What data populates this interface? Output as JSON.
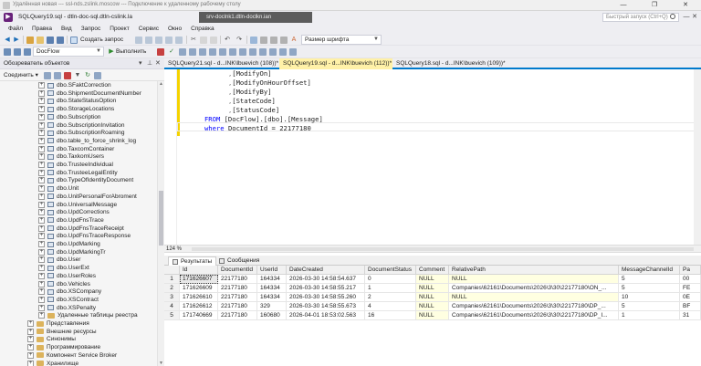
{
  "rdp": {
    "title": "Удалённая новая --- ssl-nds.zslink.moscow --- Подключение к удаленному рабочему столу",
    "buttons": [
      "—",
      "❐",
      "✕"
    ]
  },
  "ssms": {
    "doc_title": "SQLQuery19.sql - dtln-doc-sql.dtln-cslink.la",
    "connection": "srv-doclnk1.dtln-doclkn.ian",
    "quick_launch_placeholder": "Быстрый запуск (Ctrl+Q)",
    "caption_buttons": [
      "—",
      "❐",
      "✕"
    ]
  },
  "menu": [
    "Файл",
    "Правка",
    "Вид",
    "Запрос",
    "Проект",
    "Сервис",
    "Окно",
    "Справка"
  ],
  "toolbar1": {
    "new_query": "Создать запрос",
    "font_size_combo": "Размер шрифта"
  },
  "toolbar2": {
    "database": "DocFlow",
    "execute": "Выполнить"
  },
  "object_explorer": {
    "title": "Обозреватель объектов",
    "connect": "Соединить",
    "items": [
      {
        "label": "dbo.SFaktCorrection",
        "kind": "table"
      },
      {
        "label": "dbo.ShipmentDocumentNumber",
        "kind": "table"
      },
      {
        "label": "dbo.StateStatusOption",
        "kind": "table"
      },
      {
        "label": "dbo.StorageLocations",
        "kind": "table"
      },
      {
        "label": "dbo.Subscription",
        "kind": "table"
      },
      {
        "label": "dbo.SubscriptionInvitation",
        "kind": "table"
      },
      {
        "label": "dbo.SubscriptionRoaming",
        "kind": "table"
      },
      {
        "label": "dbo.table_to_force_shrink_log",
        "kind": "table"
      },
      {
        "label": "dbo.TaxcomContainer",
        "kind": "table"
      },
      {
        "label": "dbo.TaxkomUsers",
        "kind": "table"
      },
      {
        "label": "dbo.TrusteeIndividual",
        "kind": "table"
      },
      {
        "label": "dbo.TrusteeLegalEntity",
        "kind": "table"
      },
      {
        "label": "dbo.TypeOfIdentityDocument",
        "kind": "table"
      },
      {
        "label": "dbo.Unit",
        "kind": "table"
      },
      {
        "label": "dbo.UnitPersonalForAbroment",
        "kind": "table"
      },
      {
        "label": "dbo.UniversalMessage",
        "kind": "table"
      },
      {
        "label": "dbo.UpdCorrections",
        "kind": "table"
      },
      {
        "label": "dbo.UpdFnsTrace",
        "kind": "table"
      },
      {
        "label": "dbo.UpdFnsTraceReceipt",
        "kind": "table"
      },
      {
        "label": "dbo.UpdFnsTraceResponse",
        "kind": "table"
      },
      {
        "label": "dbo.UpdMarking",
        "kind": "table"
      },
      {
        "label": "dbo.UpdMarkingTr",
        "kind": "table"
      },
      {
        "label": "dbo.User",
        "kind": "table"
      },
      {
        "label": "dbo.UserExt",
        "kind": "table"
      },
      {
        "label": "dbo.UserRoles",
        "kind": "table"
      },
      {
        "label": "dbo.Vehicles",
        "kind": "table"
      },
      {
        "label": "dbo.XSCompany",
        "kind": "table"
      },
      {
        "label": "dbo.XSContract",
        "kind": "table"
      },
      {
        "label": "dbo.XSPenalty",
        "kind": "table"
      },
      {
        "label": "Удаленные таблицы реестра",
        "kind": "folder"
      },
      {
        "label": "Представления",
        "kind": "folder-root"
      },
      {
        "label": "Внешние ресурсы",
        "kind": "folder-root"
      },
      {
        "label": "Синонимы",
        "kind": "folder-root"
      },
      {
        "label": "Программирование",
        "kind": "folder-root"
      },
      {
        "label": "Компонент Service Broker",
        "kind": "folder-root"
      },
      {
        "label": "Хранилище",
        "kind": "folder-root"
      }
    ]
  },
  "tabs": [
    {
      "label": "SQLQuery21.sql - d...INK\\lbuevich (108))*",
      "active": false
    },
    {
      "label": "SQLQuery19.sql - d...INK\\buevich (112))*",
      "active": true
    },
    {
      "label": "SQLQuery18.sql - d...INK\\buevich (109))*",
      "active": false
    }
  ],
  "editor": {
    "lines": [
      {
        "indent": "            ",
        "pre": ",",
        "text": "[ModifyOn]",
        "post": ""
      },
      {
        "indent": "            ",
        "pre": ",",
        "text": "[ModifyOnHourOffset]",
        "post": ""
      },
      {
        "indent": "            ",
        "pre": ",",
        "text": "[ModifyBy]",
        "post": ""
      },
      {
        "indent": "            ",
        "pre": ",",
        "text": "[StateCode]",
        "post": ""
      },
      {
        "indent": "            ",
        "pre": ",",
        "text": "[StatusCode]",
        "post": ""
      }
    ],
    "from_kw": "FROM",
    "from_obj": "[DocFlow].[dbo].[Message]",
    "where_kw": "where",
    "where_expr": "DocumentId = 22177180"
  },
  "zoom": "124 %",
  "result_tabs": [
    "Результаты",
    "Сообщения"
  ],
  "grid": {
    "columns": [
      "Id",
      "DocumentId",
      "UserId",
      "DateCreated",
      "DocumentStatus",
      "Comment",
      "RelativePath",
      "MessageChannelId",
      "Pa"
    ],
    "rows": [
      [
        "1",
        "171626607",
        "22177180",
        "164334",
        "2026-03-30 14:58:54.637",
        "0",
        "NULL",
        "NULL",
        "5",
        "00"
      ],
      [
        "2",
        "171626609",
        "22177180",
        "164334",
        "2026-03-30 14:58:55.217",
        "1",
        "NULL",
        "Companies\\62161\\Documents\\2026\\3\\30\\22177180\\ON_...",
        "5",
        "FE"
      ],
      [
        "3",
        "171626610",
        "22177180",
        "164334",
        "2026-03-30 14:58:55.260",
        "2",
        "NULL",
        "NULL",
        "10",
        "0E"
      ],
      [
        "4",
        "171626612",
        "22177180",
        "329",
        "2026-03-30 14:58:55.673",
        "4",
        "NULL",
        "Companies\\62161\\Documents\\2026\\3\\30\\22177180\\DP_...",
        "5",
        "BF"
      ],
      [
        "5",
        "171740669",
        "22177180",
        "160680",
        "2026-04-01 18:53:02.563",
        "16",
        "NULL",
        "Companies\\62161\\Documents\\2026\\3\\30\\22177180\\DP_I...",
        "1",
        "31"
      ]
    ]
  }
}
